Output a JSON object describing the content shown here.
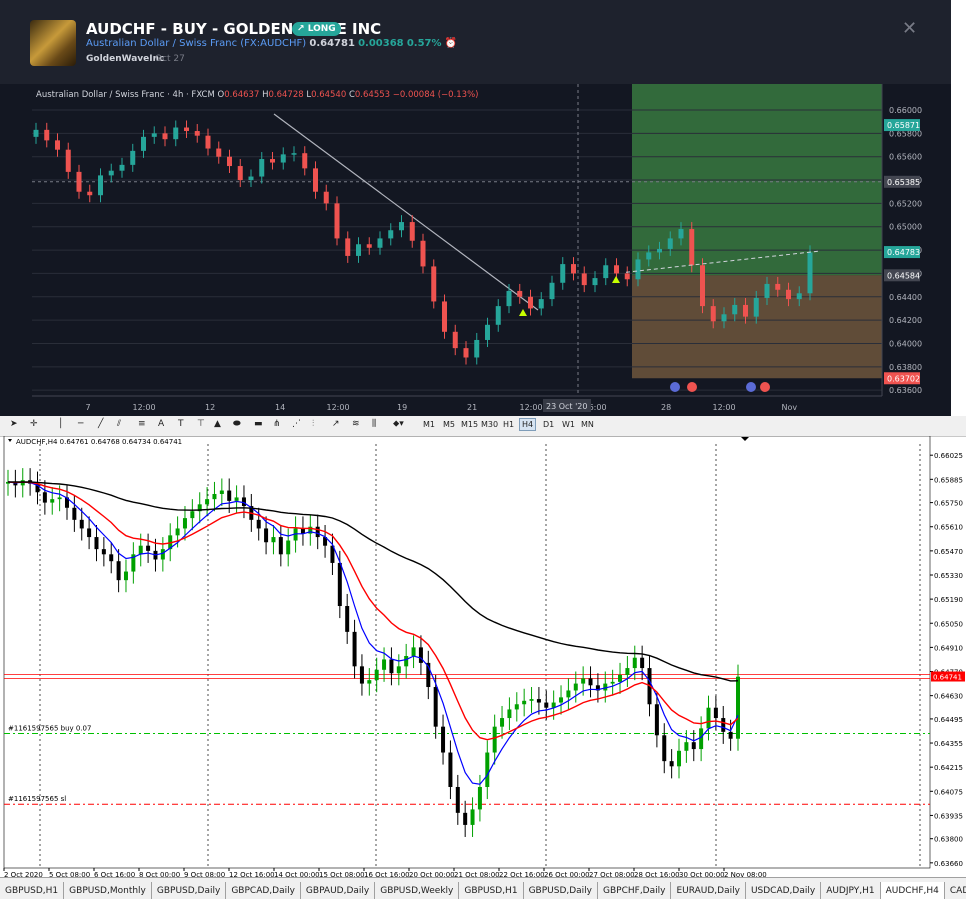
{
  "tv": {
    "title": "AUDCHF - BUY - GOLDEN WAVE INC",
    "badge": "LONG",
    "symbol_name": "Australian Dollar / Swiss Franc",
    "symbol_code": "(FX:AUDCHF)",
    "price": "0.64781",
    "change": "0.00368",
    "change_pct": "0.57%",
    "author": "GoldenWaveInc",
    "date": "Oct 27",
    "legend_name": "Australian Dollar / Swiss Franc · 4h · FXCM",
    "legend_o_label": "O",
    "legend_o": "0.64637",
    "legend_h_label": "H",
    "legend_h": "0.64728",
    "legend_l_label": "L",
    "legend_l": "0.64540",
    "legend_c_label": "C",
    "legend_c": "0.64553",
    "legend_chg": "−0.00084 (−0.13%)",
    "price_ticks": [
      "0.66000",
      "0.65800",
      "0.65600",
      "0.65400",
      "0.65200",
      "0.65000",
      "0.64800",
      "0.64600",
      "0.64400",
      "0.64200",
      "0.64000",
      "0.63800",
      "0.63600"
    ],
    "price_tags": [
      "0.65871",
      "0.65385",
      "0.64783",
      "0.64584",
      "0.63702"
    ],
    "time_ticks": [
      "7",
      "12:00",
      "12",
      "14",
      "12:00",
      "19",
      "21",
      "12:00",
      "16:00",
      "28",
      "12:00",
      "Nov"
    ],
    "crosshair_date": "23 Oct '20",
    "colors": {
      "bg": "#131722",
      "up": "#26a69a",
      "down": "#ef5350",
      "profit": "#4caf50",
      "loss": "#a0784a",
      "accent": "#2962ff"
    }
  },
  "mt": {
    "toolbar_timeframes": [
      "M1",
      "M5",
      "M15",
      "M30",
      "H1",
      "H4",
      "D1",
      "W1",
      "MN"
    ],
    "active_timeframe": "H4",
    "legend": "AUDCHF,H4  0.64761 0.64768 0.64734 0.64741",
    "price_ticks": [
      "0.66025",
      "0.65885",
      "0.65750",
      "0.65610",
      "0.65470",
      "0.65330",
      "0.65190",
      "0.65050",
      "0.64910",
      "0.64770",
      "0.64630",
      "0.64495",
      "0.64355",
      "0.64215",
      "0.64075",
      "0.63935",
      "0.63800",
      "0.63660"
    ],
    "bid_tag": "0.64741",
    "time_ticks": [
      "2 Oct 2020",
      "5 Oct 08:00",
      "6 Oct 16:00",
      "8 Oct 00:00",
      "9 Oct 08:00",
      "12 Oct 16:00",
      "14 Oct 00:00",
      "15 Oct 08:00",
      "16 Oct 16:00",
      "20 Oct 00:00",
      "21 Oct 08:00",
      "22 Oct 16:00",
      "26 Oct 00:00",
      "27 Oct 08:00",
      "28 Oct 16:00",
      "30 Oct 00:00",
      "2 Nov 08:00"
    ],
    "order_buy": "#1161597565 buy 0.07",
    "order_sl": "#1161597565 sl",
    "tabs": [
      "GBPUSD,H1",
      "GBPUSD,Monthly",
      "GBPUSD,Daily",
      "GBPCAD,Daily",
      "GBPAUD,Daily",
      "GBPUSD,Weekly",
      "GBPUSD,H1",
      "GBPUSD,Daily",
      "GBPCHF,Daily",
      "EURAUD,Daily",
      "USDCAD,Daily",
      "AUDJPY,H1",
      "AUDCHF,H4",
      "CADCHF,Daily"
    ],
    "active_tab": "AUDCHF,H4",
    "colors": {
      "bull": "#00a000",
      "bear": "#000000",
      "ma_fast": "#0000ff",
      "ma_mid": "#ff0000",
      "ma_slow": "#000000",
      "buy_line": "#00c000",
      "sl_line": "#ff0000"
    }
  },
  "chart_data": [
    {
      "type": "candlestick",
      "title": "Australian Dollar / Swiss Franc · 4h · FXCM",
      "ylim": [
        0.6355,
        0.6612
      ],
      "entry": 0.64584,
      "take_profit": 0.65871,
      "stop_loss": 0.63702,
      "close": [
        0.6583,
        0.6574,
        0.6566,
        0.6547,
        0.653,
        0.6527,
        0.6544,
        0.6548,
        0.6553,
        0.6565,
        0.6577,
        0.658,
        0.6575,
        0.6585,
        0.6582,
        0.6578,
        0.6567,
        0.656,
        0.6552,
        0.654,
        0.6543,
        0.6558,
        0.6555,
        0.6562,
        0.6563,
        0.655,
        0.653,
        0.652,
        0.649,
        0.6475,
        0.6485,
        0.6482,
        0.649,
        0.6497,
        0.6504,
        0.6488,
        0.6466,
        0.6436,
        0.641,
        0.6396,
        0.6388,
        0.6403,
        0.6416,
        0.6432,
        0.6445,
        0.644,
        0.643,
        0.6438,
        0.6452,
        0.6468,
        0.646,
        0.645,
        0.6456,
        0.6467,
        0.646,
        0.6455,
        0.6472,
        0.6478,
        0.6481,
        0.649,
        0.6498,
        0.6467,
        0.6432,
        0.6419,
        0.6425,
        0.6433,
        0.6423,
        0.6439,
        0.6451,
        0.6446,
        0.6438,
        0.6443,
        0.6478
      ],
      "open": [
        0.6577,
        0.6583,
        0.6574,
        0.6566,
        0.6547,
        0.653,
        0.6527,
        0.6544,
        0.6548,
        0.6553,
        0.6565,
        0.6577,
        0.658,
        0.6575,
        0.6585,
        0.6582,
        0.6578,
        0.6567,
        0.656,
        0.6552,
        0.654,
        0.6543,
        0.6558,
        0.6555,
        0.6562,
        0.6563,
        0.655,
        0.653,
        0.652,
        0.649,
        0.6475,
        0.6485,
        0.6482,
        0.649,
        0.6497,
        0.6504,
        0.6488,
        0.6466,
        0.6436,
        0.641,
        0.6396,
        0.6388,
        0.6403,
        0.6416,
        0.6432,
        0.6445,
        0.644,
        0.643,
        0.6438,
        0.6452,
        0.6468,
        0.646,
        0.645,
        0.6456,
        0.6467,
        0.646,
        0.6455,
        0.6472,
        0.6478,
        0.6481,
        0.649,
        0.6498,
        0.6467,
        0.6432,
        0.6419,
        0.6425,
        0.6433,
        0.6423,
        0.6439,
        0.6451,
        0.6446,
        0.6438,
        0.6443
      ]
    },
    {
      "type": "candlestick",
      "title": "AUDCHF,H4",
      "ylim": [
        0.6363,
        0.6609
      ],
      "buy_level": 0.6441,
      "sl_level": 0.64,
      "bid": 0.64741,
      "close": [
        0.6587,
        0.6585,
        0.6588,
        0.6586,
        0.6581,
        0.6575,
        0.6577,
        0.6578,
        0.6572,
        0.6565,
        0.656,
        0.6555,
        0.6548,
        0.6545,
        0.6541,
        0.653,
        0.6535,
        0.6545,
        0.655,
        0.6547,
        0.6542,
        0.6548,
        0.6556,
        0.656,
        0.6566,
        0.657,
        0.6574,
        0.6577,
        0.658,
        0.6582,
        0.6576,
        0.6578,
        0.6573,
        0.6565,
        0.656,
        0.6552,
        0.6555,
        0.6545,
        0.6553,
        0.656,
        0.6557,
        0.6561,
        0.6555,
        0.655,
        0.654,
        0.6515,
        0.65,
        0.648,
        0.647,
        0.6472,
        0.6478,
        0.6484,
        0.6476,
        0.648,
        0.6486,
        0.6491,
        0.6482,
        0.6468,
        0.6445,
        0.643,
        0.641,
        0.6395,
        0.6388,
        0.6397,
        0.641,
        0.643,
        0.6445,
        0.645,
        0.6455,
        0.6458,
        0.646,
        0.6461,
        0.6459,
        0.6456,
        0.6459,
        0.6462,
        0.6466,
        0.647,
        0.6473,
        0.6469,
        0.6466,
        0.647,
        0.6471,
        0.6475,
        0.6479,
        0.6485,
        0.6479,
        0.6458,
        0.644,
        0.6425,
        0.6422,
        0.6431,
        0.6436,
        0.6432,
        0.6444,
        0.6456,
        0.645,
        0.6442,
        0.6438,
        0.6474
      ],
      "open": [
        0.6586,
        0.6587,
        0.6585,
        0.6588,
        0.6586,
        0.6581,
        0.6575,
        0.6577,
        0.6578,
        0.6572,
        0.6565,
        0.656,
        0.6555,
        0.6548,
        0.6545,
        0.6541,
        0.653,
        0.6535,
        0.6545,
        0.655,
        0.6547,
        0.6542,
        0.6548,
        0.6556,
        0.656,
        0.6566,
        0.657,
        0.6574,
        0.6577,
        0.658,
        0.6582,
        0.6576,
        0.6578,
        0.6573,
        0.6565,
        0.656,
        0.6552,
        0.6555,
        0.6545,
        0.6553,
        0.656,
        0.6557,
        0.6561,
        0.6555,
        0.655,
        0.654,
        0.6515,
        0.65,
        0.648,
        0.647,
        0.6472,
        0.6478,
        0.6484,
        0.6476,
        0.648,
        0.6486,
        0.6491,
        0.6482,
        0.6468,
        0.6445,
        0.643,
        0.641,
        0.6395,
        0.6388,
        0.6397,
        0.641,
        0.643,
        0.6445,
        0.645,
        0.6455,
        0.6458,
        0.646,
        0.6461,
        0.6459,
        0.6456,
        0.6459,
        0.6462,
        0.6466,
        0.647,
        0.6473,
        0.6469,
        0.6466,
        0.647,
        0.6471,
        0.6475,
        0.6479,
        0.6485,
        0.6479,
        0.6458,
        0.644,
        0.6425,
        0.6422,
        0.6431,
        0.6436,
        0.6432,
        0.6444,
        0.6456,
        0.645,
        0.6442,
        0.6438
      ]
    }
  ]
}
